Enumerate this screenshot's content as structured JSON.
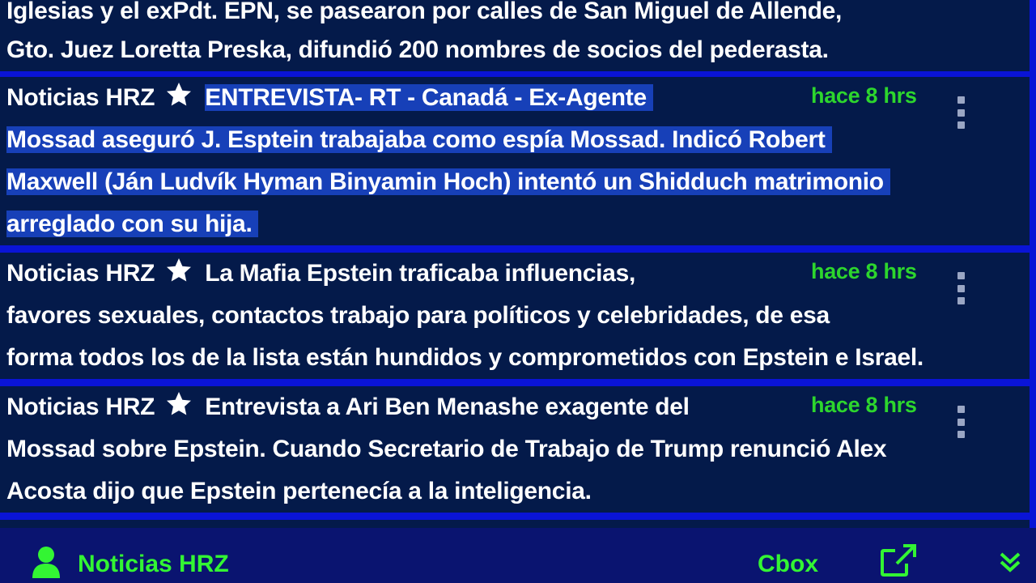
{
  "app": {
    "title": "Noticias HRZ"
  },
  "colors": {
    "background": "#0a14d6",
    "post_bg": "#041a4a",
    "highlight": "#1740b8",
    "time": "#2dd62d",
    "footer_bg": "#0a1470",
    "footer_text": "#33f533"
  },
  "posts": [
    {
      "lines": [
        "Iglesias y el exPdt. EPN, se pasearon por calles de San Miguel de Allende,",
        "Gto. Juez Loretta Preska, difundió 200 nombres de socios del pederasta."
      ]
    },
    {
      "author": "Noticias HRZ",
      "time": "hace 8 hrs",
      "first": "ENTREVISTA- RT - Canadá - Ex-Agente",
      "lines": [
        "Mossad aseguró J. Esptein trabajaba como espía Mossad. Indicó Robert",
        "Maxwell (Ján Ludvík Hyman Binyamin Hoch) intentó un Shidduch matrimonio",
        "arreglado con su hija."
      ]
    },
    {
      "author": "Noticias HRZ",
      "time": "hace 8 hrs",
      "first": "La Mafia Epstein traficaba influencias,",
      "lines": [
        "favores sexuales, contactos trabajo para políticos y celebridades, de esa",
        "forma todos los de la lista están hundidos y comprometidos con Epstein e Israel."
      ]
    },
    {
      "author": "Noticias HRZ",
      "time": "hace 8 hrs",
      "first": "Entrevista a Ari Ben Menashe exagente del",
      "lines": [
        "Mossad sobre Epstein. Cuando Secretario de Trabajo de Trump renunció Alex",
        "Acosta dijo que Epstein pertenecía a la inteligencia."
      ]
    }
  ],
  "footer": {
    "user_label": "Noticias HRZ",
    "cbox_label": "Cbox",
    "user_icon": "user-icon",
    "external_icon": "external-link-icon",
    "collapse_icon": "double-chevron-down-icon"
  }
}
